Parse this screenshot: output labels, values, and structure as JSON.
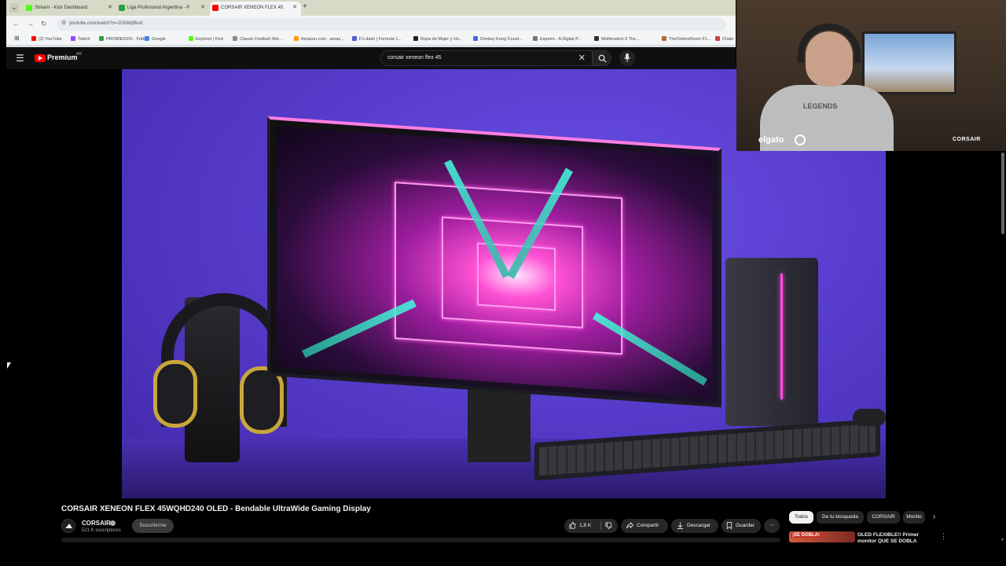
{
  "browser": {
    "tabs": [
      {
        "title": "Stream - Kick Dashboard",
        "favicon_color": "#53fc18",
        "active": false
      },
      {
        "title": "Liga Profesional Argentina - P",
        "favicon_color": "#2e9e44",
        "active": false
      },
      {
        "title": "CORSAIR XENEON FLEX 45",
        "favicon_color": "#ff0000",
        "active": true
      }
    ],
    "new_tab": "+",
    "url": "youtube.com/watch?v=1Oh8dj9ks8",
    "bookmarks": [
      {
        "label": "(3) YouTube",
        "color": "#ff0000"
      },
      {
        "label": "Twitch",
        "color": "#9146ff"
      },
      {
        "label": "PROMIEDOS - Fútb...",
        "color": "#2e9e44"
      },
      {
        "label": "Google",
        "color": "#4285f4"
      },
      {
        "label": "Explorer | Kick",
        "color": "#53fc18"
      },
      {
        "label": "Classic Football Shir...",
        "color": "#888888"
      },
      {
        "label": "Amazon.com : amaz...",
        "color": "#ff9900"
      },
      {
        "label": "F1-dash | Formula 1...",
        "color": "#5a5ad8"
      },
      {
        "label": "Ropa de Mujer y Ho...",
        "color": "#222222"
      },
      {
        "label": "Donkey Kong Count...",
        "color": "#4a6ad8"
      },
      {
        "label": "Espetro - A Digital P...",
        "color": "#777777"
      },
      {
        "label": "Wolfenstein II The...",
        "color": "#333333"
      },
      {
        "label": "TheOmbreRoom F1...",
        "color": "#b06a3a"
      },
      {
        "label": "Chaki",
        "color": "#d04040"
      }
    ]
  },
  "youtube": {
    "brand": "Premium",
    "country": "AR",
    "search_query": "corsair xeneon flex 45",
    "video_title": "CORSAIR XENEON FLEX 45WQHD240 OLED - Bendable UltraWide Gaming Display",
    "channel": {
      "name": "CORSAIR",
      "subscribers": "521 K suscriptores",
      "subscribe_label": "Suscribirme"
    },
    "actions": {
      "likes": "1,8 K",
      "share": "Compartir",
      "download": "Descargar",
      "save": "Guardar",
      "more": "⋯"
    },
    "chips": [
      {
        "label": "Todos",
        "selected": true
      },
      {
        "label": "De tu búsqueda",
        "selected": false
      },
      {
        "label": "CORSAIR",
        "selected": false
      },
      {
        "label": "Monito",
        "selected": false
      }
    ],
    "related": {
      "badge": "¡SE DOBLA!",
      "title": "OLED FLEXIBLE!! Primer monitor QUE SE DOBLA"
    }
  },
  "webcam": {
    "shirt_text": "LEGENDS",
    "camera_brand": "elgato",
    "sponsor": "CORSAIR"
  }
}
